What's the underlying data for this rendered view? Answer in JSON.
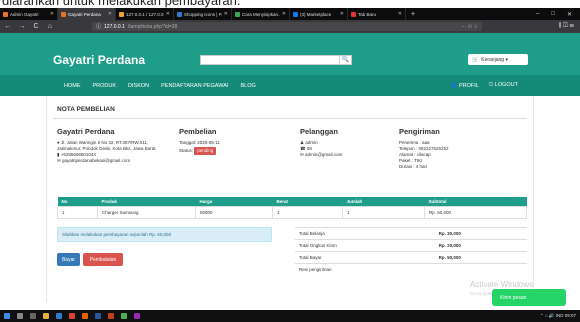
{
  "caption": "diarahkan untuk melakukan pembayaran.",
  "browser": {
    "tabs": [
      {
        "label": "Admin Gayatri",
        "color": "#e8732c"
      },
      {
        "label": "Gayatri Perdana",
        "color": "#e8732c"
      },
      {
        "label": "127.0.0.1 / 127.0.0.1",
        "color": "#f0a030"
      },
      {
        "label": "Shopping Icons | Fr...",
        "color": "#2e7bcf"
      },
      {
        "label": "Cara Menyisipkan...",
        "color": "#3aa757"
      },
      {
        "label": "(3) Marketplace",
        "color": "#1877f2"
      },
      {
        "label": "Tab Baru",
        "color": "#d33"
      }
    ],
    "new_tab": "+",
    "win_minimize": "–",
    "win_maximize": "□",
    "win_close": "✕",
    "url_host": "127.0.0.1",
    "url_path": "/tampilnota.php?id=38",
    "url_tools": "··· ☉ ☆",
    "nav_back": "←",
    "nav_forward": "→",
    "nav_reload": "C",
    "nav_home": "⌂",
    "nav_right": "⫼ ◫ ☰"
  },
  "site": {
    "brand": "Gayatri Perdana",
    "search": {
      "placeholder": "",
      "icon": "🔍"
    },
    "cart": {
      "icon": "🛒",
      "label": "Keranjang ▾"
    },
    "nav": [
      {
        "label": "HOME"
      },
      {
        "label": "PRODUK"
      },
      {
        "label": "DISKON"
      },
      {
        "label": "PENDAFTARAN PEGAWAI"
      },
      {
        "label": "BLOG"
      }
    ],
    "nav_right": [
      {
        "icon": "👤",
        "label": "PROFIL"
      },
      {
        "icon": "⎋",
        "label": "LOGOUT"
      }
    ]
  },
  "nota": {
    "title": "NOTA PEMBELIAN",
    "store": {
      "heading": "Gayatri Perdana",
      "address": "Jl. Jalan Waringin II No 32, RT.087/RW.011, Jatimakmur, Pondok Gede, Kota Bks, Jawa Barat",
      "phone": "+6285606601043",
      "email": "gayatriperdanabekasi@gmail.com"
    },
    "pembelian": {
      "heading": "Pembelian",
      "tanggal": "Tanggal: 2020-05-11",
      "status_label": "Status:",
      "status": "pending"
    },
    "pelanggan": {
      "heading": "Pelanggan",
      "name": "admin",
      "phone": "08",
      "email": "admin@gmail.com"
    },
    "pengiriman": {
      "heading": "Pengiriman",
      "penerima": "Penerima : aaa",
      "telepon": "Telepon : 082227525252",
      "alamat": "Alamat : cilacap",
      "paket": "Paket : TIKI",
      "durasi": "Durasi : 4 hari"
    },
    "table": {
      "headers": [
        "No",
        "Produk",
        "Harga",
        "Berat",
        "Jumlah",
        "Subtotal"
      ],
      "rows": [
        [
          "1",
          "Charger Samsung",
          "50000",
          "1",
          "1",
          "Rp. 50,000"
        ]
      ]
    },
    "alert": "Silahkan melakukan pembayaran sejumlah Rp. 50,000",
    "btn_bayar": "Bayar",
    "btn_batal": "Pembatalan",
    "totals": [
      {
        "label": "Total Belanja",
        "value": "Rp. 30,000"
      },
      {
        "label": "Total Ongkos Kirim",
        "value": "Rp. 20,000"
      },
      {
        "label": "Total Bayar",
        "value": "Rp. 50,000"
      },
      {
        "label": "Resi pengiriman",
        "value": ""
      }
    ]
  },
  "overlay": {
    "watermark": "Activate Windows",
    "watermark_sub": "Go to Settings to activate Windows.",
    "chat_button": "Kirim pesan"
  },
  "taskbar": {
    "tray": "⌃ ⌂ 🔊 IND 09:07"
  }
}
